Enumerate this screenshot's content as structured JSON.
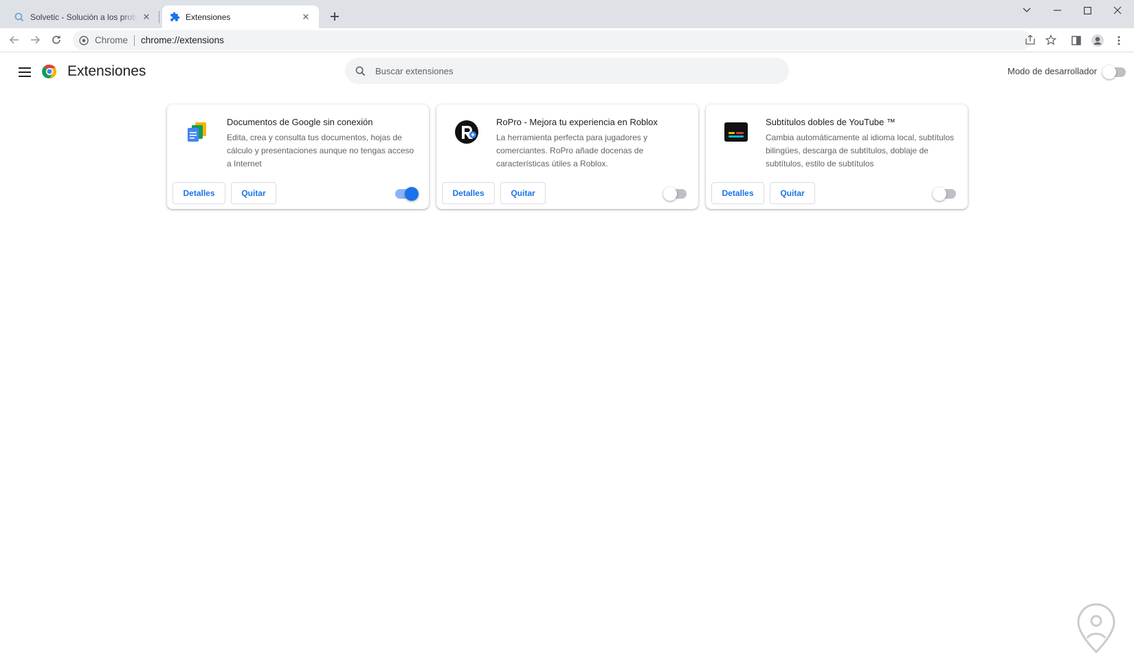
{
  "tabs": [
    {
      "title": "Solvetic - Solución a los problemas informáticos",
      "icon": "search-icon",
      "active": false
    },
    {
      "title": "Extensiones",
      "icon": "puzzle-icon",
      "active": true
    }
  ],
  "omnibox": {
    "chip": "Chrome",
    "url": "chrome://extensions"
  },
  "page": {
    "title": "Extensiones",
    "search_placeholder": "Buscar extensiones",
    "dev_mode_label": "Modo de desarrollador",
    "dev_mode_enabled": false
  },
  "extensions": [
    {
      "name": "Documentos de Google sin conexión",
      "description": "Edita, crea y consulta tus documentos, hojas de cálculo y presentaciones aunque no tengas acceso a Internet",
      "details_label": "Detalles",
      "remove_label": "Quitar",
      "enabled": true,
      "icon": "google-docs-offline-icon"
    },
    {
      "name": "RoPro - Mejora tu experiencia en Roblox",
      "description": "La herramienta perfecta para jugadores y comerciantes. RoPro añade docenas de características útiles a Roblox.",
      "details_label": "Detalles",
      "remove_label": "Quitar",
      "enabled": false,
      "icon": "ropro-icon"
    },
    {
      "name": "Subtítulos dobles de YouTube ™",
      "description": "Cambia automáticamente al idioma local, subtítulos bilingües, descarga de subtítulos, doblaje de subtítulos, estilo de subtítulos",
      "details_label": "Detalles",
      "remove_label": "Quitar",
      "enabled": false,
      "icon": "subtitles-icon"
    }
  ],
  "colors": {
    "accent": "#1a73e8",
    "tabstrip": "#dee1e6",
    "omnibox": "#f1f3f4"
  }
}
